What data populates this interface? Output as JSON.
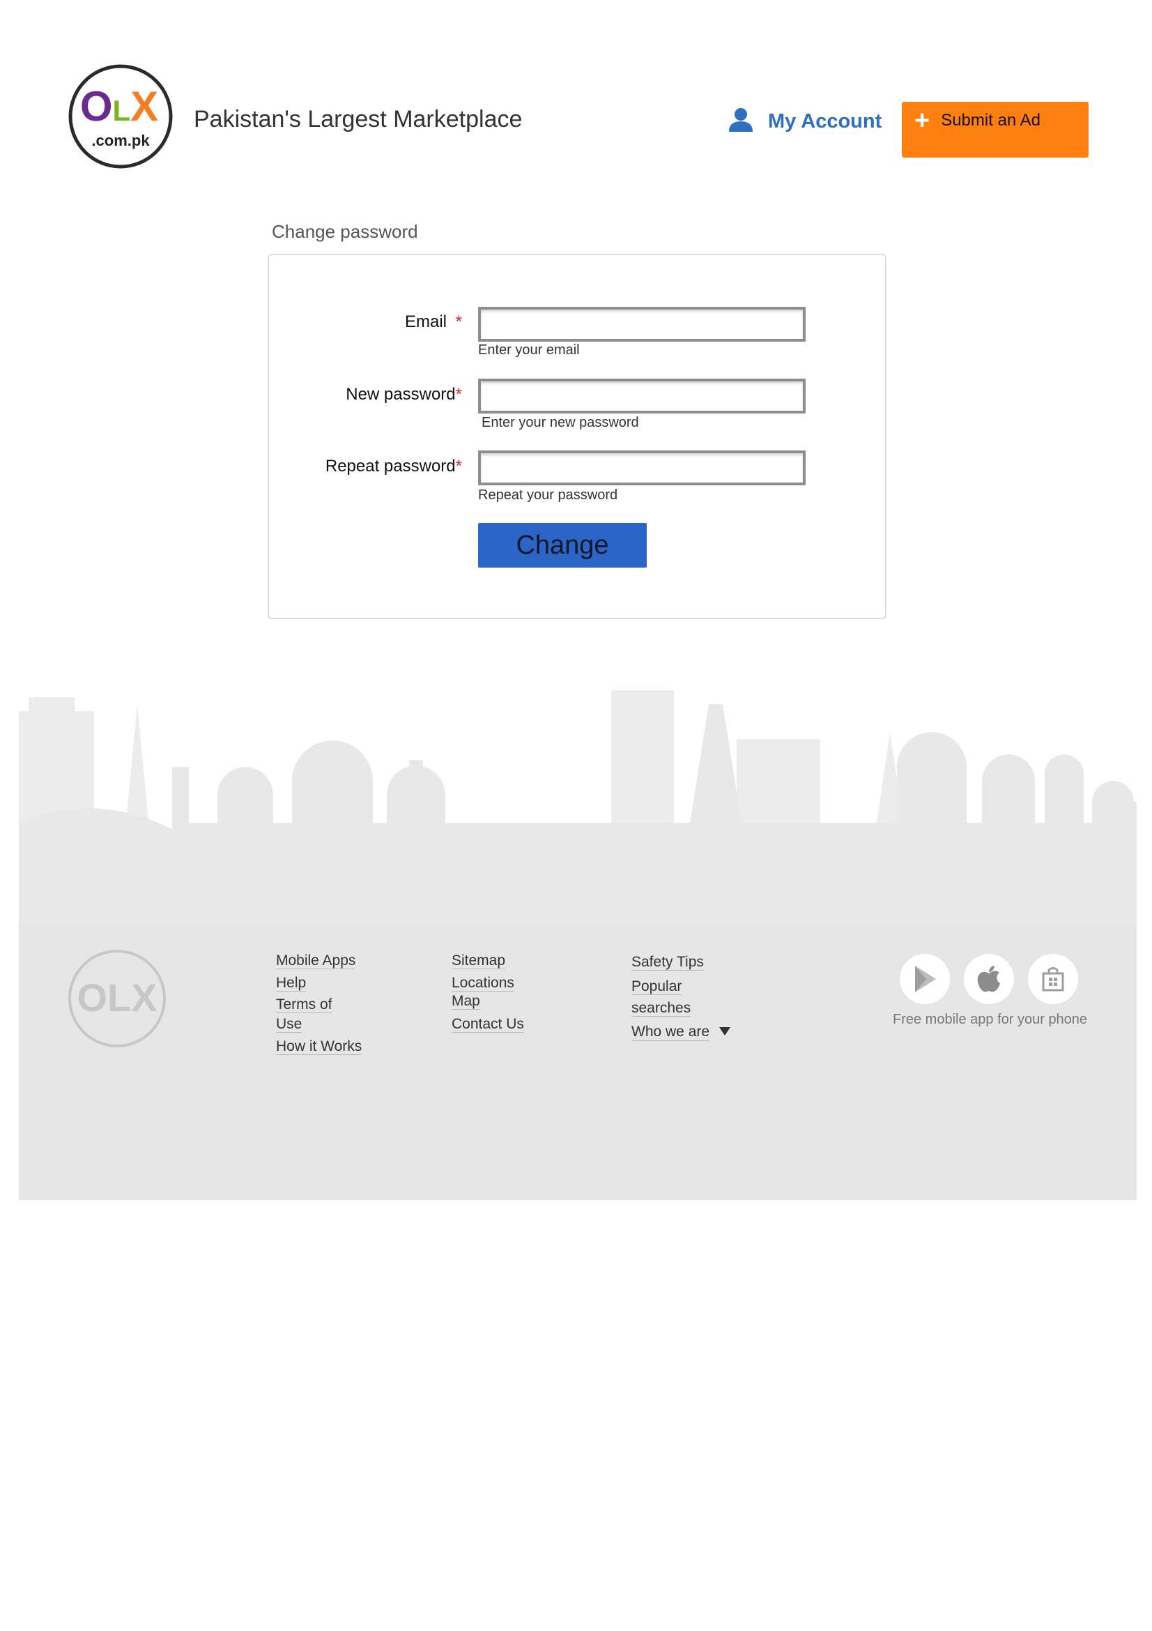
{
  "header": {
    "logo_text": "OLX",
    "logo_sub": ".com.pk",
    "tagline": "Pakistan's Largest Marketplace",
    "account_label": "My Account",
    "submit_label": "Submit an Ad",
    "submit_plus": "+"
  },
  "form": {
    "title": "Change password",
    "fields": [
      {
        "label": "Email",
        "required": "*",
        "hint": "Enter your email",
        "value": ""
      },
      {
        "label": "New password",
        "required": "*",
        "hint": "Enter your new password",
        "value": ""
      },
      {
        "label": "Repeat password",
        "required": "*",
        "hint": "Repeat your password",
        "value": ""
      }
    ],
    "submit_label": "Change"
  },
  "footer": {
    "columns": [
      {
        "links": [
          "Mobile Apps",
          "Help",
          "Terms of",
          "Use",
          "How it Works"
        ]
      },
      {
        "links": [
          "Sitemap",
          "Locations",
          "Map",
          "Contact Us"
        ]
      },
      {
        "links": [
          "Safety Tips",
          "Popular",
          "searches",
          "Who we are"
        ]
      }
    ],
    "app_caption": "Free mobile app for your phone",
    "app_icons": [
      "google-play-icon",
      "apple-icon",
      "windows-store-icon"
    ]
  },
  "colors": {
    "accent_blue": "#2f6fc1",
    "submit_orange": "#ff7f0f",
    "change_button": "#2b65c8",
    "footer_bg": "#e6e6e6",
    "logo_purple": "#6a2a8f",
    "logo_green": "#7ab51d",
    "logo_orange": "#f47f20"
  }
}
